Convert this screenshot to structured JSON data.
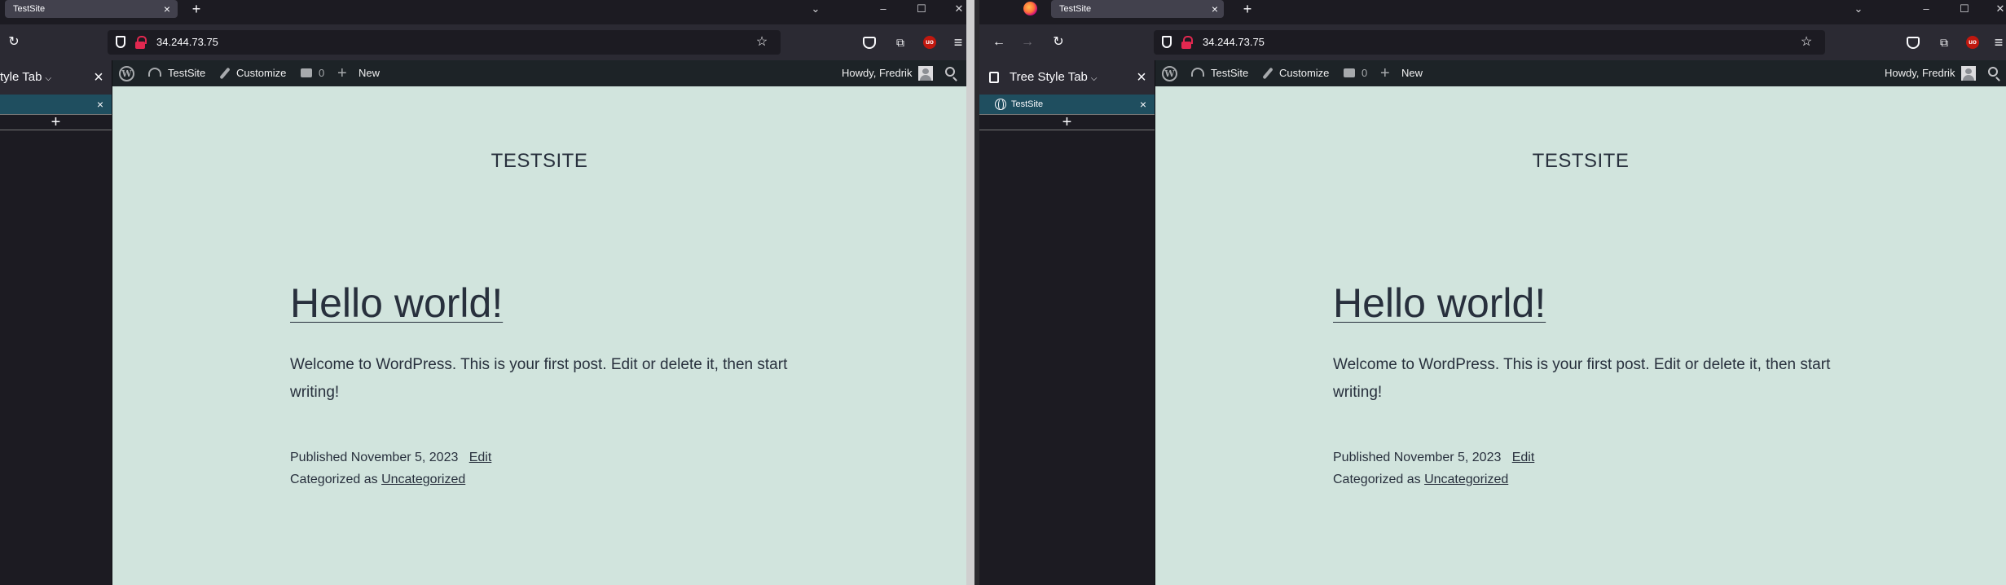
{
  "left_window": {
    "tab": {
      "title": "TestSite"
    },
    "url": "34.244.73.75",
    "sidebar": {
      "title": "Tree Style Tab",
      "title_visible": "tyle Tab",
      "tabs": [
        {
          "label": "TestSite"
        }
      ]
    }
  },
  "right_window": {
    "tab": {
      "title": "TestSite"
    },
    "url": "34.244.73.75",
    "sidebar": {
      "title": "Tree Style Tab",
      "tabs": [
        {
          "label": "TestSite"
        }
      ]
    }
  },
  "admin_bar": {
    "site_name": "TestSite",
    "customize_label": "Customize",
    "comments_count": "0",
    "new_label": "New",
    "greeting": "Howdy, Fredrik"
  },
  "page": {
    "site_title": "TESTSITE",
    "post_title": "Hello world!",
    "post_body": "Welcome to WordPress. This is your first post. Edit or delete it, then start writing!",
    "published_prefix": "Published",
    "published_date": "November 5, 2023",
    "edit_label": "Edit",
    "categorized_prefix": "Categorized as",
    "category": "Uncategorized"
  },
  "colors": {
    "page_background": "#d1e4dd",
    "admin_bar": "#1d2327",
    "browser_chrome": "#2b2a33",
    "active_tree_tab": "#1f4e5f",
    "lock_warning": "#e22850"
  },
  "icons": [
    "firefox-logo-icon",
    "close-icon",
    "plus-icon",
    "chevron-down-icon",
    "minimize-icon",
    "maximize-icon",
    "back-icon",
    "forward-icon",
    "reload-icon",
    "shield-icon",
    "insecure-lock-icon",
    "bookmark-star-icon",
    "pocket-icon",
    "extensions-icon",
    "ublock-icon",
    "hamburger-menu-icon",
    "wordpress-logo-icon",
    "dashboard-icon",
    "customize-brush-icon",
    "comment-bubble-icon",
    "globe-icon",
    "avatar",
    "search-icon"
  ]
}
